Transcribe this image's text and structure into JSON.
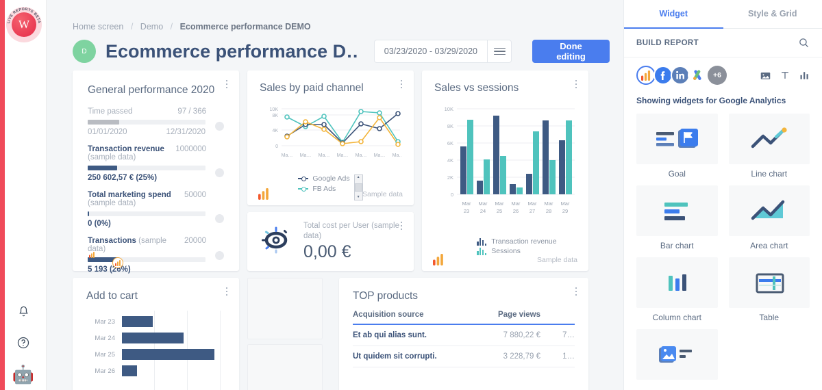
{
  "brand": {
    "logo_arc_text": "LIVE REPORTS BETA",
    "logo_letter": "W",
    "stripe_color": "#f04b5a"
  },
  "rail": {
    "notifications_icon": "bell-icon",
    "help_icon": "question-circle-icon",
    "assistant_icon": "robot-icon",
    "assistant_glyph": "🤖"
  },
  "breadcrumb": {
    "home": "Home screen",
    "section": "Demo",
    "current": "Ecommerce performance DEMO",
    "separator": "/"
  },
  "header": {
    "avatar_letter": "D",
    "title": "Ecommerce performance D…",
    "date_range": "03/23/2020 - 03/29/2020",
    "menu_icon": "hamburger-icon",
    "done_label": "Done editing",
    "accent_blue": "#4a7dee",
    "avatar_green": "#7ed3a0"
  },
  "cards": {
    "general": {
      "title": "General performance 2020",
      "kpis": [
        {
          "name": "Time passed",
          "sub": "",
          "goal": "97 / 366",
          "progress": 27,
          "foot_left": "01/01/2020",
          "foot_right": "12/31/2020",
          "value": "",
          "grey": true
        },
        {
          "name": "Transaction revenue",
          "sub": "(sample data)",
          "goal": "1000000",
          "progress": 25,
          "value": "250 602,57 € (25%)"
        },
        {
          "name": "Total marketing spend",
          "sub": "(sample data)",
          "goal": "50000",
          "progress": 1,
          "value": "0 (0%)"
        },
        {
          "name": "Transactions",
          "sub": "(sample data)",
          "goal": "20000",
          "progress": 26,
          "value": "5 193 (26%)"
        }
      ]
    },
    "paid_channel": {
      "title": "Sales by paid channel",
      "sample": "Sample data"
    },
    "sessions": {
      "title": "Sales vs sessions",
      "sample": "Sample data"
    },
    "cost": {
      "label": "Total cost per User (sample data)",
      "value": "0,00 €",
      "icon": "eye-icon"
    },
    "add_to_cart": {
      "title": "Add to cart"
    },
    "top_products": {
      "title": "TOP products",
      "columns": [
        "Acquisition source",
        "Page views",
        ""
      ],
      "rows": [
        {
          "name": "Et ab qui alias sunt.",
          "revenue": "7 880,22 €",
          "views": "7…"
        },
        {
          "name": "Ut quidem sit corrupti.",
          "revenue": "3 228,79 €",
          "views": "1…"
        }
      ]
    }
  },
  "chart_data": [
    {
      "type": "line",
      "title": "Sales by paid channel",
      "x": [
        "Ma…",
        "Ma…",
        "Ma…",
        "Ma…",
        "Ma…",
        "Ma…",
        "Ma…"
      ],
      "ylim": [
        0,
        10000
      ],
      "yticks": [
        0,
        4000,
        8000,
        10000
      ],
      "ytick_labels": [
        "0",
        "4K",
        "8K",
        "10K"
      ],
      "grid": true,
      "legend_position": "bottom",
      "series": [
        {
          "name": "Google Ads",
          "color": "#3b5278",
          "values": [
            2400,
            5600,
            5600,
            1300,
            5900,
            4700,
            9000
          ]
        },
        {
          "name": "FB Ads",
          "color": "#4fc3bd",
          "values": [
            8200,
            6400,
            8000,
            1500,
            9500,
            9200,
            1700
          ]
        },
        {
          "name": "",
          "color": "#f3b53c",
          "values": [
            2300,
            6500,
            4500,
            900,
            1400,
            7700,
            700
          ]
        }
      ]
    },
    {
      "type": "bar",
      "title": "Sales vs sessions",
      "categories": [
        "Mar 23",
        "Mar 24",
        "Mar 25",
        "Mar 26",
        "Mar 27",
        "Mar 28",
        "Mar 29"
      ],
      "ylim": [
        0,
        10000
      ],
      "yticks": [
        0,
        2000,
        4000,
        6000,
        8000,
        10000
      ],
      "ytick_labels": [
        "0",
        "2K",
        "4K",
        "6K",
        "8K",
        "10K"
      ],
      "grid": true,
      "legend_position": "bottom",
      "series": [
        {
          "name": "Transaction revenue",
          "color": "#3e5a83",
          "values": [
            5600,
            1600,
            9200,
            1200,
            2400,
            8600,
            6300
          ]
        },
        {
          "name": "Sessions",
          "color": "#4fc3bd",
          "values": [
            8700,
            4100,
            4500,
            800,
            7400,
            4000,
            8600
          ]
        }
      ]
    },
    {
      "type": "bar",
      "orientation": "horizontal",
      "title": "Add to cart",
      "categories": [
        "Mar 23",
        "Mar 24",
        "Mar 25",
        "Mar 26"
      ],
      "values": [
        45,
        90,
        135,
        12
      ],
      "color": "#3e5a83",
      "grid": true
    }
  ],
  "panel": {
    "tabs": [
      {
        "label": "Widget",
        "active": true
      },
      {
        "label": "Style & Grid",
        "active": false
      }
    ],
    "build_report": "BUILD REPORT",
    "search_icon": "search-icon",
    "sources": [
      {
        "name": "google-analytics-icon",
        "selected": true
      },
      {
        "name": "facebook-icon",
        "selected": false
      },
      {
        "name": "linkedin-icon",
        "selected": false
      },
      {
        "name": "google-ads-icon",
        "selected": false
      }
    ],
    "more_sources": "+6",
    "tools": [
      "image-icon",
      "text-icon",
      "chart-icon"
    ],
    "showing_text": "Showing widgets for Google Analytics",
    "widgets": [
      {
        "label": "Goal",
        "icon": "goal-icon"
      },
      {
        "label": "Line chart",
        "icon": "line-chart-icon"
      },
      {
        "label": "Bar chart",
        "icon": "bar-chart-icon"
      },
      {
        "label": "Area chart",
        "icon": "area-chart-icon"
      },
      {
        "label": "Column chart",
        "icon": "column-chart-icon"
      },
      {
        "label": "Table",
        "icon": "table-icon"
      },
      {
        "label": "",
        "icon": "image-widget-icon"
      }
    ]
  }
}
